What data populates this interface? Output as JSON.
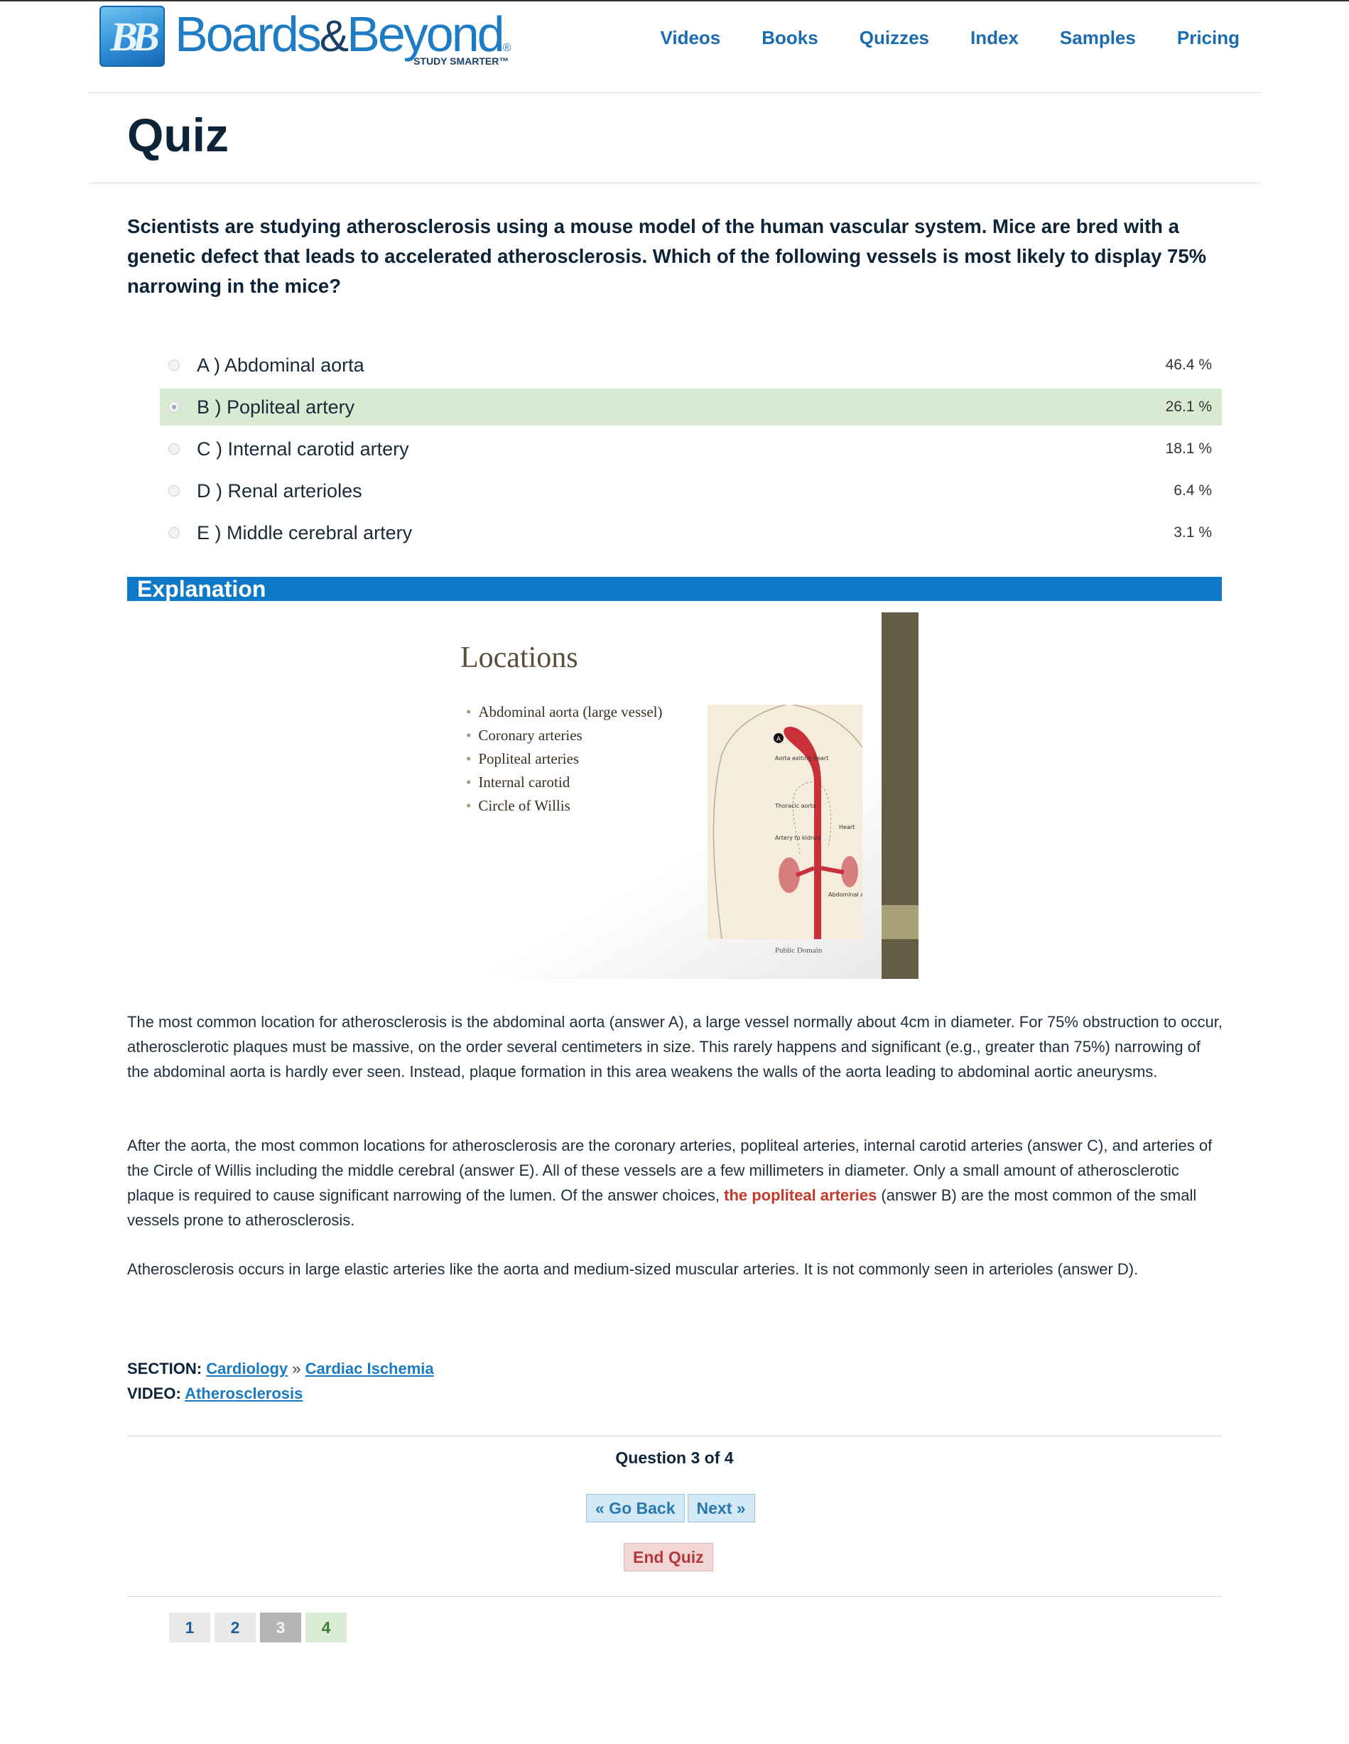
{
  "header": {
    "brand_word": "Boards",
    "brand_amp": "&",
    "brand_word2": "Beyond",
    "brand_registered": "®",
    "brand_tagline": "STUDY SMARTER™",
    "logo_mark": "BB",
    "nav": [
      "Videos",
      "Books",
      "Quizzes",
      "Index",
      "Samples",
      "Pricing"
    ]
  },
  "page_title": "Quiz",
  "question": "Scientists are studying atherosclerosis using a mouse model of the human vascular system. Mice are bred with a genetic defect that leads to accelerated atherosclerosis. Which of the following vessels is most likely to display 75% narrowing in the mice?",
  "options": [
    {
      "label": "A ) Abdominal aorta",
      "pct": "46.4 %",
      "selected": false
    },
    {
      "label": "B ) Popliteal artery",
      "pct": "26.1 %",
      "selected": true
    },
    {
      "label": "C ) Internal carotid artery",
      "pct": "18.1 %",
      "selected": false
    },
    {
      "label": "D ) Renal arterioles",
      "pct": "6.4 %",
      "selected": false
    },
    {
      "label": "E ) Middle cerebral artery",
      "pct": "3.1 %",
      "selected": false
    }
  ],
  "explanation_heading": "Explanation",
  "slide": {
    "title": "Locations",
    "bullets": [
      "Abdominal aorta (large vessel)",
      "Coronary arteries",
      "Popliteal arteries",
      "Internal carotid",
      "Circle of Willis"
    ],
    "figure_labels": {
      "marker": "A",
      "aorta_exiting": "Aorta exiting heart",
      "thoracic": "Thoracic aorta",
      "heart": "Heart",
      "kidney_artery": "Artery to kidney",
      "abdominal": "Abdominal aorta"
    },
    "credit": "Public Domain"
  },
  "paragraphs": {
    "p1": "The most common location for atherosclerosis is the abdominal aorta (answer A), a large vessel normally about 4cm in diameter. For 75% obstruction to occur, atherosclerotic plaques must be massive, on the order several centimeters in size. This rarely happens and significant (e.g., greater than 75%) narrowing of the abdominal aorta is hardly ever seen. Instead, plaque formation in this area weakens the walls of the aorta leading to abdominal aortic aneurysms.",
    "p2_before": "After the aorta, the most common locations for atherosclerosis are the coronary arteries, popliteal arteries, internal carotid arteries (answer C), and arteries of the Circle of Willis including the middle cerebral (answer E). All of these vessels are a few millimeters in diameter. Only a small amount of atherosclerotic plaque is required to cause significant narrowing of the lumen. Of the answer choices, ",
    "p2_highlight": "the popliteal arteries",
    "p2_after": " (answer B) are the most common of the small vessels prone to atherosclerosis.",
    "p3": "Atherosclerosis occurs in large elastic arteries like the aorta and medium-sized muscular arteries. It is not commonly seen in arterioles (answer D)."
  },
  "meta": {
    "section_label": "SECTION:",
    "section_link1": "Cardiology",
    "section_sep": "»",
    "section_link2": "Cardiac Ischemia",
    "video_label": "VIDEO:",
    "video_link": "Atherosclerosis"
  },
  "navigation": {
    "question_count": "Question 3 of 4",
    "go_back": "« Go Back",
    "next": "Next »",
    "end_quiz": "End Quiz",
    "pages": [
      "1",
      "2",
      "3",
      "4"
    ]
  },
  "colors": {
    "brand_blue": "#1d7cc4",
    "explanation_bar": "#0d79c8",
    "selected_row": "#d9ead3",
    "highlight_red": "#c0392b"
  }
}
